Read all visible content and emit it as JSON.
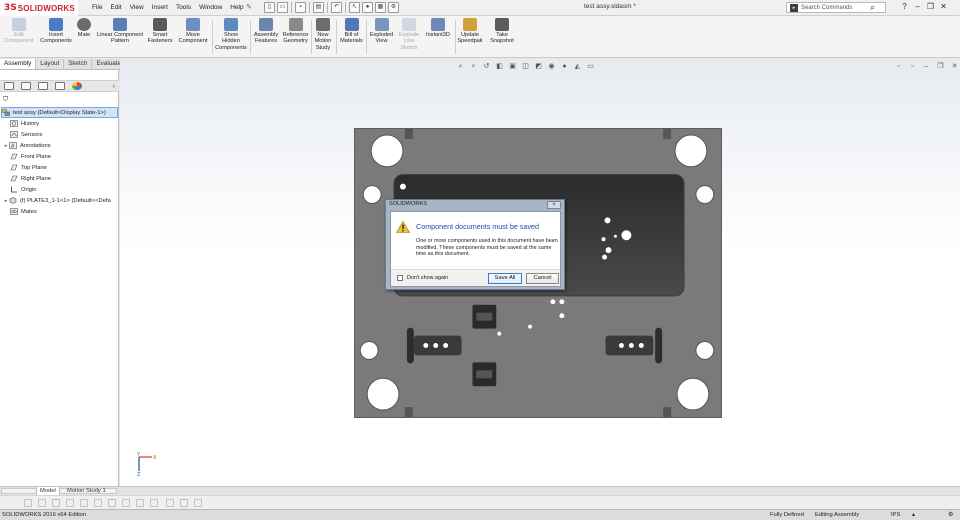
{
  "app": {
    "logo_mark": "3S",
    "logo_text": "SOLIDWORKS",
    "document_title": "test assy.sldasm *",
    "search_placeholder": "Search Commands"
  },
  "menu": [
    "File",
    "Edit",
    "View",
    "Insert",
    "Tools",
    "Window",
    "Help"
  ],
  "command_manager": [
    {
      "label": "Edit\nComponent",
      "enabled": false,
      "color": "#8fa4c7"
    },
    {
      "label": "Insert\nComponents",
      "enabled": true,
      "color": "#4a7cc4"
    },
    {
      "label": "Mate",
      "enabled": true,
      "color": "#6b6b6b"
    },
    {
      "label": "Linear Component\nPattern",
      "enabled": true,
      "color": "#5a7fb8"
    },
    {
      "label": "Smart\nFasteners",
      "enabled": true,
      "color": "#5a5a5a"
    },
    {
      "label": "Move\nComponent",
      "enabled": true,
      "color": "#6e8fbf"
    },
    {
      "label": "Show\nHidden\nComponents",
      "enabled": true,
      "color": "#5e8ac2"
    },
    {
      "label": "Assembly\nFeatures",
      "enabled": true,
      "color": "#6a86b0"
    },
    {
      "label": "Reference\nGeometry",
      "enabled": true,
      "color": "#8a8a8a"
    },
    {
      "label": "New\nMotion\nStudy",
      "enabled": true,
      "color": "#6d6d6d"
    },
    {
      "label": "Bill of\nMaterials",
      "enabled": true,
      "color": "#4f79b6"
    },
    {
      "label": "Exploded\nView",
      "enabled": true,
      "color": "#7a95c0"
    },
    {
      "label": "Explode\nLine\nSketch",
      "enabled": false,
      "color": "#a8b6cc"
    },
    {
      "label": "Instant3D",
      "enabled": true,
      "color": "#6c88b6"
    },
    {
      "label": "Update\nSpeedpak",
      "enabled": true,
      "color": "#d2a23a"
    },
    {
      "label": "Take\nSnapshot",
      "enabled": true,
      "color": "#5c5c5c"
    }
  ],
  "tabs": [
    "Assembly",
    "Layout",
    "Sketch",
    "Evaluate"
  ],
  "active_tab": "Assembly",
  "feature_tree": [
    {
      "label": "test assy  (Default<Display State-1>)",
      "icon": "assembly-icon",
      "root": true
    },
    {
      "label": "History",
      "icon": "history-icon"
    },
    {
      "label": "Sensors",
      "icon": "sensors-icon"
    },
    {
      "label": "Annotations",
      "icon": "annotations-icon",
      "expandable": true
    },
    {
      "label": "Front Plane",
      "icon": "plane-icon"
    },
    {
      "label": "Top Plane",
      "icon": "plane-icon"
    },
    {
      "label": "Right Plane",
      "icon": "plane-icon"
    },
    {
      "label": "Origin",
      "icon": "origin-icon"
    },
    {
      "label": "(f) PLATE3_1-1<1> (Default<<Defa",
      "icon": "part-icon",
      "expandable": true
    },
    {
      "label": "Mates",
      "icon": "mates-icon"
    }
  ],
  "dialog": {
    "title": "SOLIDWORKS",
    "close_label": "×",
    "heading": "Component documents must be saved",
    "message": "One or more components used in this document have been modified. These components must be saved at the same time as this document.",
    "checkbox_label": "Don't show again",
    "save_all_label": "Save All",
    "cancel_label": "Cancel"
  },
  "triad": {
    "x_label": "X",
    "y_label": "Y",
    "z_label": "Z"
  },
  "bottom_tabs": [
    "Model",
    "Motion Study 1"
  ],
  "active_bottom_tab": "Model",
  "status": {
    "edition": "SOLIDWORKS 2016 x64 Edition",
    "definition": "Fully Defined",
    "mode": "Editing Assembly",
    "units": "IPS"
  }
}
